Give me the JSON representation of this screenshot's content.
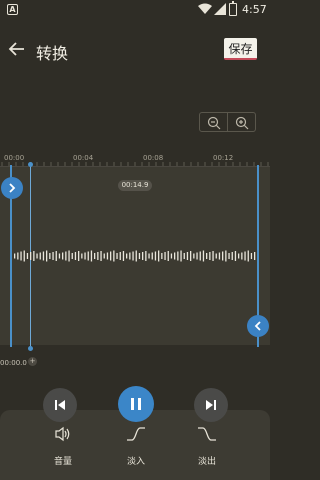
{
  "status_bar": {
    "app_badge": "A",
    "time": "4:57"
  },
  "header": {
    "title": "转换",
    "save_label": "保存"
  },
  "ruler": {
    "ticks": [
      "00:00",
      "00:04",
      "00:08",
      "00:12"
    ]
  },
  "editor": {
    "selection_duration": "00:14.9",
    "position_readout": "00:00.0",
    "position_add": "+"
  },
  "tools": {
    "volume_label": "音量",
    "fade_in_label": "淡入",
    "fade_out_label": "淡出"
  },
  "colors": {
    "accent": "#3b86c8",
    "background": "#2f2d26",
    "track": "#3c3a31"
  },
  "icons": {
    "back": "arrow-left-icon",
    "zoom_out": "zoom-out-icon",
    "zoom_in": "zoom-in-icon",
    "prev": "skip-previous-icon",
    "pause": "pause-icon",
    "next": "skip-next-icon",
    "volume": "volume-icon",
    "fade_in": "fade-in-icon",
    "fade_out": "fade-out-icon"
  }
}
